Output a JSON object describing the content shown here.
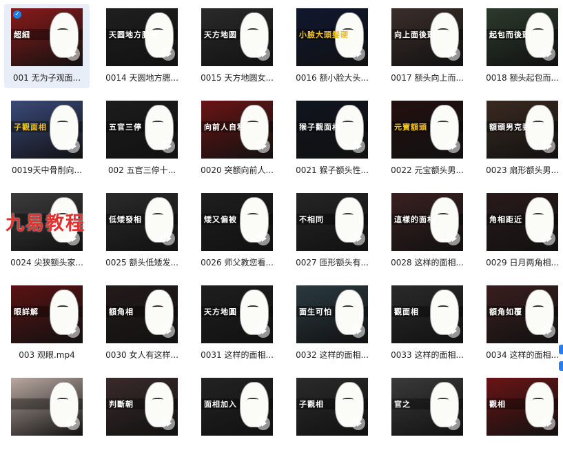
{
  "watermark": "九易教程",
  "colors": {
    "selected_bg": "#e8eef8",
    "accent": "#1e7fe0",
    "watermark": "#e5302d"
  },
  "items": [
    {
      "label": "001 无为子观面...",
      "caption": "超細",
      "bg": "#8b1a1a",
      "cap_color": "#ffffff",
      "selected": true
    },
    {
      "label": "0014 天圆地方腮...",
      "caption": "天圆地方腮骨",
      "bg": "#1f1f1f",
      "cap_color": "#ffffff",
      "selected": false
    },
    {
      "label": "0015 天方地圆女...",
      "caption": "天方地圆",
      "bg": "#2a2a2a",
      "cap_color": "#ffffff",
      "selected": false
    },
    {
      "label": "0016 额小脸大头...",
      "caption": "小臉大頭髮硬",
      "bg": "#101830",
      "cap_color": "#f2c21a",
      "selected": false
    },
    {
      "label": "0017 额头向上而...",
      "caption": "向上面後頭",
      "bg": "#3b2e2a",
      "cap_color": "#ffffff",
      "selected": false
    },
    {
      "label": "0018 额头起包而...",
      "caption": "起包而後頭",
      "bg": "#2c3a2c",
      "cap_color": "#ffffff",
      "selected": false
    },
    {
      "label": "0019天中骨削向...",
      "caption": "子觀面相",
      "bg": "#3a4a7a",
      "cap_color": "#f2c21a",
      "selected": false
    },
    {
      "label": "002 五官三停十...",
      "caption": "五官三停",
      "bg": "#1c1c1c",
      "cap_color": "#ffffff",
      "selected": false
    },
    {
      "label": "0020 突额向前人...",
      "caption": "向前人自私",
      "bg": "#6a1414",
      "cap_color": "#ffffff",
      "selected": false
    },
    {
      "label": "0021 猴子额头性...",
      "caption": "猴子觀面相",
      "bg": "#10141e",
      "cap_color": "#ffffff",
      "selected": false
    },
    {
      "label": "0022 元宝额头男...",
      "caption": "元寶額頭",
      "bg": "#231010",
      "cap_color": "#f2c21a",
      "selected": false
    },
    {
      "label": "0023 扇形额头男...",
      "caption": "額頭男克妻",
      "bg": "#3a2a20",
      "cap_color": "#ffffff",
      "selected": false
    },
    {
      "label": "0024 尖狭额头家...",
      "caption": "",
      "bg": "#3c3c3c",
      "cap_color": "#ffffff",
      "selected": false
    },
    {
      "label": "0025 额头低矮发...",
      "caption": "低矮發相",
      "bg": "#2a2a2a",
      "cap_color": "#ffffff",
      "selected": false
    },
    {
      "label": "0026 师父教您看...",
      "caption": "矮又偏被",
      "bg": "#1e1e1e",
      "cap_color": "#ffffff",
      "selected": false
    },
    {
      "label": "0027 匝形额头有...",
      "caption": "不相同",
      "bg": "#252525",
      "cap_color": "#ffffff",
      "selected": false
    },
    {
      "label": "0028 这样的面相...",
      "caption": "這樣的面相",
      "bg": "#3a2020",
      "cap_color": "#ffffff",
      "selected": false
    },
    {
      "label": "0029 日月两角相...",
      "caption": "角相距近",
      "bg": "#2a1a1a",
      "cap_color": "#ffffff",
      "selected": false
    },
    {
      "label": "003 观眼.mp4",
      "caption": "眼詳解",
      "bg": "#5a1212",
      "cap_color": "#ffffff",
      "selected": false
    },
    {
      "label": "0030 女人有这样...",
      "caption": "額角相",
      "bg": "#241a1a",
      "cap_color": "#ffffff",
      "selected": false
    },
    {
      "label": "0031 这样的面相...",
      "caption": "天方地圓",
      "bg": "#1e1e1e",
      "cap_color": "#ffffff",
      "selected": false
    },
    {
      "label": "0032 这样的面相...",
      "caption": "面生可怕",
      "bg": "#2a3a40",
      "cap_color": "#ffffff",
      "selected": false
    },
    {
      "label": "0033 这样的面相...",
      "caption": "觀面相",
      "bg": "#2a2a2a",
      "cap_color": "#ffffff",
      "selected": false
    },
    {
      "label": "0034 这样的面相...",
      "caption": "額角如覆",
      "bg": "#3a1e1e",
      "cap_color": "#ffffff",
      "selected": false
    },
    {
      "label": "",
      "caption": "",
      "bg": "#b8a8a0",
      "cap_color": "#ffffff",
      "selected": false
    },
    {
      "label": "",
      "caption": "判斷朝",
      "bg": "#3a2a2a",
      "cap_color": "#ffffff",
      "selected": false
    },
    {
      "label": "",
      "caption": "面相加入",
      "bg": "#222222",
      "cap_color": "#ffffff",
      "selected": false
    },
    {
      "label": "",
      "caption": "子觀相",
      "bg": "#2a2a2a",
      "cap_color": "#ffffff",
      "selected": false
    },
    {
      "label": "",
      "caption": "官之",
      "bg": "#3a3a3a",
      "cap_color": "#ffffff",
      "selected": false
    },
    {
      "label": "",
      "caption": "觀相",
      "bg": "#6a1414",
      "cap_color": "#ffffff",
      "selected": false
    }
  ]
}
